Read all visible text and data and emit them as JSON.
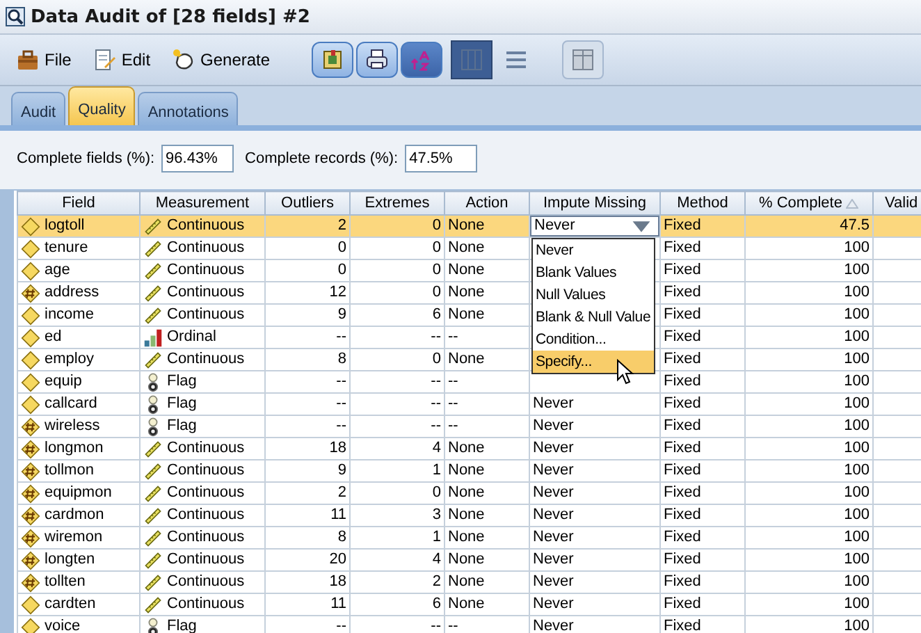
{
  "window": {
    "title": "Data Audit of [28 fields] #2"
  },
  "menu": [
    {
      "label": "File"
    },
    {
      "label": "Edit"
    },
    {
      "label": "Generate"
    }
  ],
  "view_buttons": [
    {
      "selected": true
    },
    {
      "selected": false
    },
    {
      "selected": false
    }
  ],
  "tabs": [
    {
      "label": "Audit",
      "selected": false
    },
    {
      "label": "Quality",
      "selected": true
    },
    {
      "label": "Annotations",
      "selected": false
    }
  ],
  "summary": [
    {
      "label": "Complete fields (%):",
      "value": "96.43%"
    },
    {
      "label": "Complete records (%):",
      "value": "47.5%"
    }
  ],
  "table": {
    "columns": [
      {
        "label": "Field"
      },
      {
        "label": "Measurement"
      },
      {
        "label": "Outliers"
      },
      {
        "label": "Extremes"
      },
      {
        "label": "Action"
      },
      {
        "label": "Impute Missing"
      },
      {
        "label": "Method"
      },
      {
        "label": "% Complete",
        "sorted": true
      },
      {
        "label": "Valid"
      }
    ],
    "rows": [
      {
        "field": {
          "name": "logtoll",
          "kind": "plain"
        },
        "measurement": {
          "label": "Continuous",
          "kind": "continuous"
        },
        "outliers": "2",
        "extremes": "0",
        "action": "None",
        "impute_missing": "Never",
        "editing": true,
        "method": "Fixed",
        "complete": "47.5",
        "selected": true
      },
      {
        "field": {
          "name": "tenure",
          "kind": "plain"
        },
        "measurement": {
          "label": "Continuous",
          "kind": "continuous"
        },
        "outliers": "0",
        "extremes": "0",
        "action": "None",
        "method": "Fixed",
        "complete": "100",
        "selected": false
      },
      {
        "field": {
          "name": "age",
          "kind": "plain"
        },
        "measurement": {
          "label": "Continuous",
          "kind": "continuous"
        },
        "outliers": "0",
        "extremes": "0",
        "action": "None",
        "method": "Fixed",
        "complete": "100",
        "selected": false
      },
      {
        "field": {
          "name": "address",
          "kind": "integer"
        },
        "measurement": {
          "label": "Continuous",
          "kind": "continuous"
        },
        "outliers": "12",
        "extremes": "0",
        "action": "None",
        "method": "Fixed",
        "complete": "100",
        "selected": false
      },
      {
        "field": {
          "name": "income",
          "kind": "plain"
        },
        "measurement": {
          "label": "Continuous",
          "kind": "continuous"
        },
        "outliers": "9",
        "extremes": "6",
        "action": "None",
        "method": "Fixed",
        "complete": "100",
        "selected": false
      },
      {
        "field": {
          "name": "ed",
          "kind": "plain"
        },
        "measurement": {
          "label": "Ordinal",
          "kind": "ordinal"
        },
        "outliers": "--",
        "extremes": "--",
        "action": "--",
        "method": "Fixed",
        "complete": "100",
        "selected": false
      },
      {
        "field": {
          "name": "employ",
          "kind": "plain"
        },
        "measurement": {
          "label": "Continuous",
          "kind": "continuous"
        },
        "outliers": "8",
        "extremes": "0",
        "action": "None",
        "method": "Fixed",
        "complete": "100",
        "selected": false
      },
      {
        "field": {
          "name": "equip",
          "kind": "plain"
        },
        "measurement": {
          "label": "Flag",
          "kind": "flag"
        },
        "outliers": "--",
        "extremes": "--",
        "action": "--",
        "method": "Fixed",
        "complete": "100",
        "selected": false
      },
      {
        "field": {
          "name": "callcard",
          "kind": "plain"
        },
        "measurement": {
          "label": "Flag",
          "kind": "flag"
        },
        "outliers": "--",
        "extremes": "--",
        "action": "--",
        "impute_missing": "Never",
        "method": "Fixed",
        "complete": "100",
        "selected": false
      },
      {
        "field": {
          "name": "wireless",
          "kind": "integer"
        },
        "measurement": {
          "label": "Flag",
          "kind": "flag"
        },
        "outliers": "--",
        "extremes": "--",
        "action": "--",
        "impute_missing": "Never",
        "method": "Fixed",
        "complete": "100",
        "selected": false
      },
      {
        "field": {
          "name": "longmon",
          "kind": "integer"
        },
        "measurement": {
          "label": "Continuous",
          "kind": "continuous"
        },
        "outliers": "18",
        "extremes": "4",
        "action": "None",
        "impute_missing": "Never",
        "method": "Fixed",
        "complete": "100",
        "selected": false
      },
      {
        "field": {
          "name": "tollmon",
          "kind": "integer"
        },
        "measurement": {
          "label": "Continuous",
          "kind": "continuous"
        },
        "outliers": "9",
        "extremes": "1",
        "action": "None",
        "impute_missing": "Never",
        "method": "Fixed",
        "complete": "100",
        "selected": false
      },
      {
        "field": {
          "name": "equipmon",
          "kind": "integer"
        },
        "measurement": {
          "label": "Continuous",
          "kind": "continuous"
        },
        "outliers": "2",
        "extremes": "0",
        "action": "None",
        "impute_missing": "Never",
        "method": "Fixed",
        "complete": "100",
        "selected": false
      },
      {
        "field": {
          "name": "cardmon",
          "kind": "integer"
        },
        "measurement": {
          "label": "Continuous",
          "kind": "continuous"
        },
        "outliers": "11",
        "extremes": "3",
        "action": "None",
        "impute_missing": "Never",
        "method": "Fixed",
        "complete": "100",
        "selected": false
      },
      {
        "field": {
          "name": "wiremon",
          "kind": "integer"
        },
        "measurement": {
          "label": "Continuous",
          "kind": "continuous"
        },
        "outliers": "8",
        "extremes": "1",
        "action": "None",
        "impute_missing": "Never",
        "method": "Fixed",
        "complete": "100",
        "selected": false
      },
      {
        "field": {
          "name": "longten",
          "kind": "integer"
        },
        "measurement": {
          "label": "Continuous",
          "kind": "continuous"
        },
        "outliers": "20",
        "extremes": "4",
        "action": "None",
        "impute_missing": "Never",
        "method": "Fixed",
        "complete": "100",
        "selected": false
      },
      {
        "field": {
          "name": "tollten",
          "kind": "integer"
        },
        "measurement": {
          "label": "Continuous",
          "kind": "continuous"
        },
        "outliers": "18",
        "extremes": "2",
        "action": "None",
        "impute_missing": "Never",
        "method": "Fixed",
        "complete": "100",
        "selected": false
      },
      {
        "field": {
          "name": "cardten",
          "kind": "plain"
        },
        "measurement": {
          "label": "Continuous",
          "kind": "continuous"
        },
        "outliers": "11",
        "extremes": "6",
        "action": "None",
        "impute_missing": "Never",
        "method": "Fixed",
        "complete": "100",
        "selected": false
      },
      {
        "field": {
          "name": "voice",
          "kind": "plain"
        },
        "measurement": {
          "label": "Flag",
          "kind": "flag"
        },
        "outliers": "--",
        "extremes": "--",
        "action": "--",
        "impute_missing": "Never",
        "method": "Fixed",
        "complete": "100",
        "selected": false
      }
    ]
  },
  "dropdown": {
    "options": [
      {
        "label": "Never",
        "selected": false
      },
      {
        "label": "Blank Values",
        "selected": false
      },
      {
        "label": "Null Values",
        "selected": false
      },
      {
        "label": "Blank & Null Value",
        "selected": false
      },
      {
        "label": "Condition...",
        "selected": false
      },
      {
        "label": "Specify...",
        "selected": true
      }
    ]
  }
}
